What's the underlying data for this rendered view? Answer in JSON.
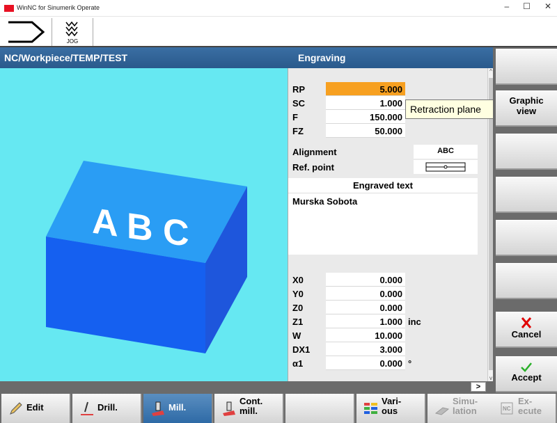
{
  "window": {
    "title": "WinNC for Sinumerik Operate"
  },
  "toolbar": {
    "mode": "JOG"
  },
  "path": "NC/Workpiece/TEMP/TEST",
  "header": "Engraving",
  "graphic": {
    "text": "A B C"
  },
  "form": {
    "rp": {
      "label": "RP",
      "value": "5.000"
    },
    "sc": {
      "label": "SC",
      "value": "1.000"
    },
    "f": {
      "label": "F",
      "value": "150.000"
    },
    "fz": {
      "label": "FZ",
      "value": "50.000"
    },
    "alignment": {
      "label": "Alignment",
      "value": "ABC"
    },
    "refpoint": {
      "label": "Ref. point"
    },
    "engraved_text": {
      "label": "Engraved text",
      "value": "Murska Sobota"
    },
    "x0": {
      "label": "X0",
      "value": "0.000"
    },
    "y0": {
      "label": "Y0",
      "value": "0.000"
    },
    "z0": {
      "label": "Z0",
      "value": "0.000"
    },
    "z1": {
      "label": "Z1",
      "value": "1.000",
      "unit": "inc"
    },
    "w": {
      "label": "W",
      "value": "10.000"
    },
    "dx1": {
      "label": "DX1",
      "value": "3.000"
    },
    "a1": {
      "label": "α1",
      "value": "0.000",
      "unit": "°"
    }
  },
  "tooltip": "Retraction plane",
  "scroll_button": ">",
  "vertical_softkeys": {
    "graphic_view": {
      "line1": "Graphic",
      "line2": "view"
    },
    "cancel": "Cancel",
    "accept": "Accept"
  },
  "horizontal_softkeys": {
    "edit": "Edit",
    "drill": "Drill.",
    "mill": "Mill.",
    "cont_mill": {
      "line1": "Cont.",
      "line2": "mill."
    },
    "various": {
      "line1": "Vari-",
      "line2": "ous"
    },
    "simulation": {
      "line1": "Simu-",
      "line2": "lation"
    },
    "execute": {
      "line1": "Ex-",
      "line2": "ecute"
    }
  },
  "colors": {
    "active_field": "#f7a020",
    "graphic_bg": "#66e8f2",
    "header_blue": "#2a5a8c"
  }
}
